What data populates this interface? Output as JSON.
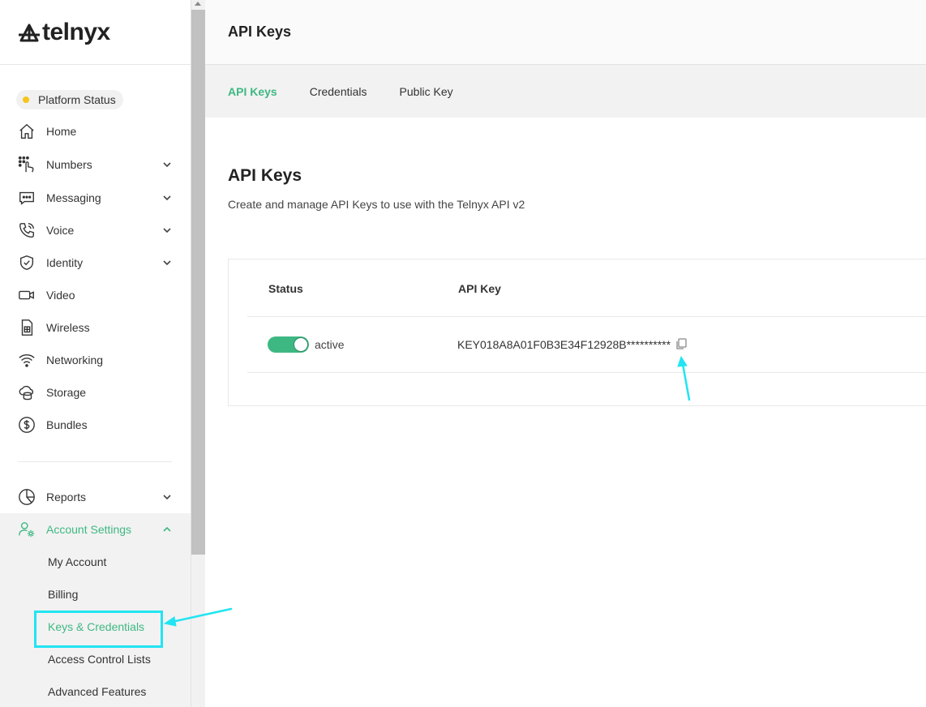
{
  "brand": {
    "name": "telnyx"
  },
  "platform_status": {
    "label": "Platform Status",
    "dot_color": "#f5c518"
  },
  "sidebar": {
    "items": [
      {
        "label": "Home",
        "icon": "home-icon"
      },
      {
        "label": "Numbers",
        "icon": "numbers-icon",
        "expandable": true
      },
      {
        "label": "Messaging",
        "icon": "messaging-icon",
        "expandable": true
      },
      {
        "label": "Voice",
        "icon": "voice-icon",
        "expandable": true
      },
      {
        "label": "Identity",
        "icon": "shield-icon",
        "expandable": true
      },
      {
        "label": "Video",
        "icon": "video-icon"
      },
      {
        "label": "Wireless",
        "icon": "sim-card-icon"
      },
      {
        "label": "Networking",
        "icon": "wifi-icon"
      },
      {
        "label": "Storage",
        "icon": "cloud-storage-icon"
      },
      {
        "label": "Bundles",
        "icon": "dollar-icon"
      }
    ],
    "bottom_items": [
      {
        "label": "Reports",
        "icon": "pie-chart-icon",
        "expandable": true
      },
      {
        "label": "Account Settings",
        "icon": "user-gear-icon",
        "expanded": true
      }
    ],
    "account_submenu": [
      {
        "label": "My Account"
      },
      {
        "label": "Billing"
      },
      {
        "label": "Keys & Credentials",
        "current": true
      },
      {
        "label": "Access Control Lists"
      },
      {
        "label": "Advanced Features"
      }
    ]
  },
  "header": {
    "title": "API Keys"
  },
  "tabs": [
    {
      "label": "API Keys",
      "active": true
    },
    {
      "label": "Credentials"
    },
    {
      "label": "Public Key"
    }
  ],
  "main": {
    "title": "API Keys",
    "description": "Create and manage API Keys to use with the Telnyx API v2",
    "table": {
      "columns": [
        "Status",
        "API Key"
      ],
      "rows": [
        {
          "enabled": true,
          "status": "active",
          "api_key": "KEY018A8A01F0B3E34F12928B**********"
        }
      ]
    }
  },
  "colors": {
    "accent": "#3eb883",
    "annotation": "#22e4f2"
  }
}
